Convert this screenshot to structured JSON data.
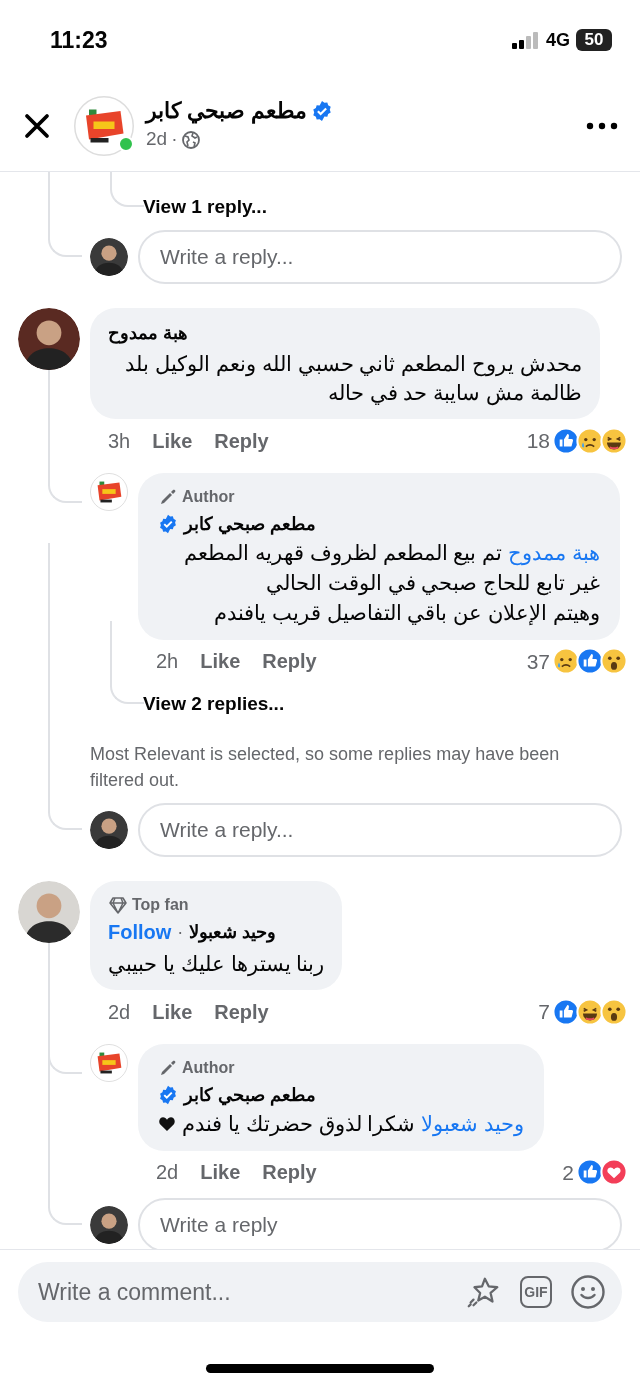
{
  "status_bar": {
    "time": "11:23",
    "network": "4G",
    "battery": "50"
  },
  "header": {
    "page_name": "مطعم صبحي كابر",
    "verified": true,
    "online": true,
    "time": "2d",
    "separator": "·"
  },
  "thread_top": {
    "view_replies": "View 1 reply...",
    "reply_placeholder": "Write a reply..."
  },
  "comments": [
    {
      "author": "هبة ممدوح",
      "text": "محدش يروح المطعم ثاني حسبي الله ونعم الوكيل بلد ظالمة مش سايبة حد في حاله",
      "time": "3h",
      "like": "Like",
      "reply": "Reply",
      "count": "18",
      "reactions": [
        {
          "kind": "like"
        },
        {
          "kind": "sad"
        },
        {
          "kind": "haha"
        }
      ],
      "replies": [
        {
          "badge": "Author",
          "author": "مطعم صبحي كابر",
          "verified": true,
          "mention": "هبة ممدوح",
          "text": "تم بيع المطعم لظروف قهريه المطعم غير تابع للحاج صبحي في الوقت الحالي\nوهيتم الإعلان عن باقي التفاصيل قريب يافندم",
          "heart": false,
          "time": "2h",
          "like": "Like",
          "reply": "Reply",
          "count": "37",
          "reactions": [
            {
              "kind": "sad"
            },
            {
              "kind": "like"
            },
            {
              "kind": "wow"
            }
          ]
        }
      ],
      "view_more": "View 2 replies...",
      "notice": "Most Relevant is selected, so some replies may have been filtered out.",
      "reply_placeholder": "Write a reply..."
    },
    {
      "badge": "Top fan",
      "author": "وحيد شعبولا",
      "follow": "Follow",
      "separator": "·",
      "text": "ربنا يسترها عليك يا حبيبي",
      "time": "2d",
      "like": "Like",
      "reply": "Reply",
      "count": "7",
      "reactions": [
        {
          "kind": "like"
        },
        {
          "kind": "haha"
        },
        {
          "kind": "wow"
        }
      ],
      "replies": [
        {
          "badge": "Author",
          "author": "مطعم صبحي كابر",
          "verified": true,
          "mention": "وحيد شعبولا",
          "text": "شكرا لذوق حضرتك يا فندم",
          "heart": true,
          "time": "2d",
          "like": "Like",
          "reply": "Reply",
          "count": "2",
          "reactions": [
            {
              "kind": "like"
            },
            {
              "kind": "love"
            }
          ]
        }
      ],
      "reply_placeholder": "Write a reply"
    }
  ],
  "composer": {
    "placeholder": "Write a comment...",
    "gif_label": "GIF"
  }
}
